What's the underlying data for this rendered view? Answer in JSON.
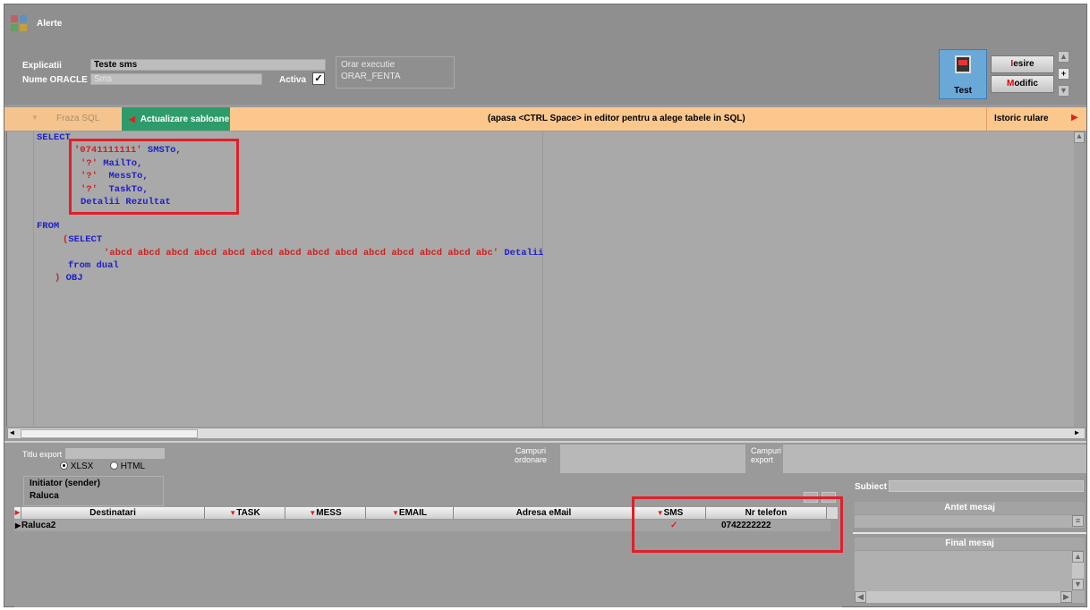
{
  "window": {
    "title": "Alerte"
  },
  "header": {
    "explicatii_label": "Explicatii",
    "explicatii_value": "Teste sms",
    "nume_oracle_label": "Nume ORACLE",
    "nume_oracle_value": "Sms",
    "activa_label": "Activa",
    "activa_checked": "✓",
    "orar_label": "Orar executie",
    "orar_value": "ORAR_FENTA",
    "test_label": "Test",
    "iesire_accel": "I",
    "iesire_rest": "esire",
    "modific_accel": "M",
    "modific_rest": "odific",
    "plus": "+"
  },
  "toolbar": {
    "fraza_sql": "Fraza SQL",
    "actualizare": "Actualizare sabloane",
    "hint": "(apasa <CTRL Space> in editor pentru a alege tabele in SQL)",
    "istoric": "Istoric rulare"
  },
  "editor": {
    "l1_kw": "SELECT",
    "l2_str": "'0741111111'",
    "l2_kw": " SMSTo,",
    "l3_str": "'?'",
    "l3_kw": " MailTo,",
    "l4_str": "'?'",
    "l4_kw": "  MessTo,",
    "l5_str": "'?'",
    "l5_kw": "  TaskTo,",
    "l6_kw": "Detalii Rezultat",
    "l7_kw": "FROM",
    "l8_str": "(",
    "l8_kw": "SELECT",
    "l9_str": "'abcd abcd abcd abcd abcd abcd abcd abcd abcd abcd abcd abcd abcd abc'",
    "l9_kw": " Detalii",
    "l10_kw": "from dual",
    "l11_str": ")",
    "l11_kw": " OBJ"
  },
  "export": {
    "titlu_label": "Titlu export",
    "titlu_value": "",
    "xlsx": "XLSX",
    "html": "HTML",
    "campuri_ord_1": "Campuri",
    "campuri_ord_2": "ordonare",
    "campuri_exp_1": "Campuri",
    "campuri_exp_2": "export"
  },
  "sender": {
    "label": "Initiator (sender)",
    "value": "Raluca"
  },
  "grid": {
    "columns": [
      "Destinatari",
      "TASK",
      "MESS",
      "EMAIL",
      "Adresa eMail",
      "SMS",
      "Nr telefon"
    ],
    "rows": [
      {
        "destinatar": "Raluca2",
        "task": "",
        "mess": "",
        "email": "",
        "adresa": "",
        "sms": "✓",
        "telefon": "0742222222"
      }
    ]
  },
  "right_panel": {
    "subiect_label": "Subiect",
    "antet_label": "Antet mesaj",
    "final_label": "Final mesaj"
  },
  "colors": {
    "orange": "#fcc78d",
    "green": "#2e9b6b",
    "highlight": "#e0202a",
    "keyword": "#2020c8",
    "string": "#d02020"
  }
}
